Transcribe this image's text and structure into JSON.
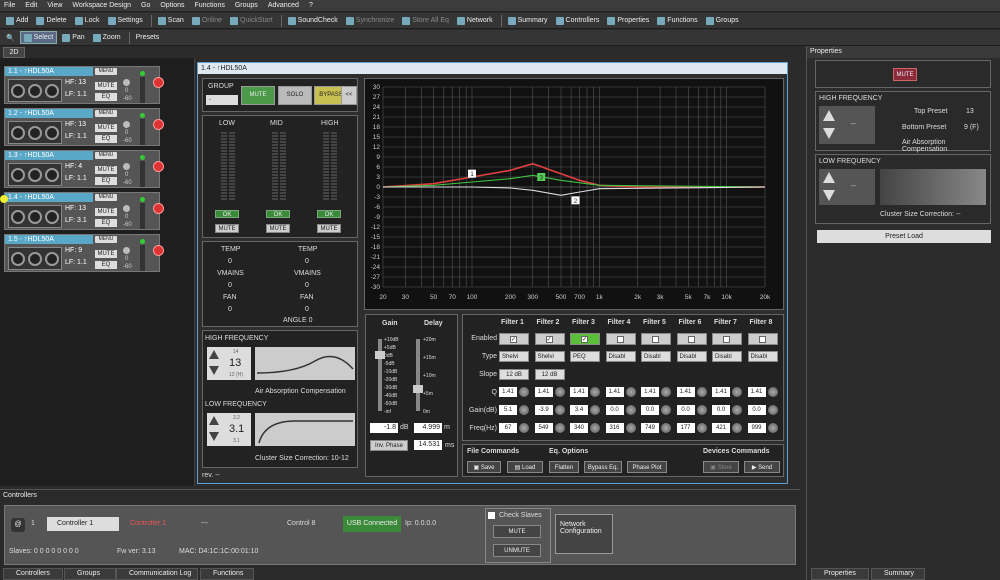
{
  "menubar": [
    "File",
    "Edit",
    "View",
    "Workspace Design",
    "Go",
    "Options",
    "Functions",
    "Groups",
    "Advanced",
    "?"
  ],
  "toolbar1": [
    {
      "label": "Add"
    },
    {
      "label": "Delete"
    },
    {
      "label": "Lock"
    },
    {
      "label": "Settings"
    },
    {
      "label": "Scan"
    },
    {
      "label": "Online",
      "disabled": true
    },
    {
      "label": "QuickStart",
      "disabled": true
    },
    {
      "label": "SoundCheck"
    },
    {
      "label": "Synchronize",
      "disabled": true
    },
    {
      "label": "Store All Eq",
      "disabled": true
    },
    {
      "label": "Network"
    },
    {
      "label": "Summary"
    },
    {
      "label": "Controllers"
    },
    {
      "label": "Properties"
    },
    {
      "label": "Functions"
    },
    {
      "label": "Groups"
    }
  ],
  "toolbar2": {
    "select": "Select",
    "pan": "Pan",
    "zoom": "Zoom",
    "presets": "Presets"
  },
  "tab2d": "2D",
  "devices": [
    {
      "name": "1.1 - ↑HDL50A",
      "hf": "HF: 13",
      "lf": "LF: 1.1",
      "menu": "MENU",
      "mute": "MUTE",
      "eq": "EQ",
      "top": "0",
      "bot": "-60",
      "alert": false
    },
    {
      "name": "1.2 - ↑HDL50A",
      "hf": "HF: 13",
      "lf": "LF: 1.1",
      "menu": "MENU",
      "mute": "MUTE",
      "eq": "EQ",
      "top": "0",
      "bot": "-60",
      "alert": false
    },
    {
      "name": "1.3 - ↑HDL50A",
      "hf": "HF: 4",
      "lf": "LF: 1.1",
      "menu": "MENU",
      "mute": "MUTE",
      "eq": "EQ",
      "top": "0",
      "bot": "-60",
      "alert": false
    },
    {
      "name": "1.4 - ↑HDL50A",
      "hf": "HF: 13",
      "lf": "LF: 3.1",
      "menu": "MENU",
      "mute": "MUTE",
      "eq": "EQ",
      "top": "0",
      "bot": "-60",
      "alert": true
    },
    {
      "name": "1.5 - ↑HDL50A",
      "hf": "HF: 9",
      "lf": "LF: 1.1",
      "menu": "MENU",
      "mute": "MUTE",
      "eq": "EQ",
      "top": "0",
      "bot": "-60",
      "alert": false
    }
  ],
  "window": {
    "title": "1.4 - ↑HDL50A",
    "group_label": "GROUP",
    "group_value": "-",
    "mute": "MUTE",
    "solo": "SOLO",
    "bypass": "BYPASS",
    "collapse": "<<",
    "bands": [
      {
        "label": "LOW",
        "ok": "OK",
        "mute": "MUTE"
      },
      {
        "label": "MID",
        "ok": "OK",
        "mute": "MUTE"
      },
      {
        "label": "HIGH",
        "ok": "OK",
        "mute": "MUTE"
      }
    ],
    "status": {
      "temp": "TEMP",
      "vmains": "VMAINS",
      "fan": "FAN",
      "angle": "ANGLE 0",
      "v": "0"
    },
    "hf": {
      "title": "HIGH FREQUENCY",
      "value": "13",
      "top": "14",
      "bot": "12 (H)",
      "caption": "Air Absorption Compensation"
    },
    "lf": {
      "title": "LOW FREQUENCY",
      "value": "3.1",
      "top": "3.2",
      "bot": "3.1",
      "caption": "Cluster Size Correction: 10-12"
    },
    "rev": "rev. --",
    "gain_label": "Gain",
    "delay_label": "Delay",
    "gain_scale": [
      "+10dB",
      "+5dB",
      "0dB",
      "-5dB",
      "-10dB",
      "-20dB",
      "-30dB",
      "-40dB",
      "-50dB",
      "-inf"
    ],
    "delay_scale": [
      "+20m",
      "+15m",
      "+10m",
      "+5m",
      "0m"
    ],
    "gain_value": "-1.8",
    "gain_unit": "dB",
    "delay_value": "4.999",
    "delay_unit": "m",
    "inv_phase": "Inv. Phase",
    "delay_ms": "14.531",
    "ms_unit": "ms"
  },
  "chart_data": {
    "type": "line",
    "y_ticks": [
      "30",
      "27",
      "24",
      "21",
      "18",
      "15",
      "12",
      "9",
      "6",
      "3",
      "0",
      "-3",
      "-6",
      "-9",
      "-12",
      "-15",
      "-18",
      "-21",
      "-24",
      "-27",
      "-30"
    ],
    "x_ticks": [
      "20",
      "30",
      "50",
      "70",
      "100",
      "200",
      "300",
      "500",
      "700",
      "1k",
      "2k",
      "3k",
      "5k",
      "7k",
      "10k",
      "20k"
    ],
    "ylim": [
      -30,
      30
    ],
    "x_scale": "log",
    "xlim": [
      20,
      20000
    ],
    "series": [
      {
        "color": "#e04040",
        "x": [
          20,
          50,
          100,
          200,
          300,
          500,
          700,
          1000,
          2000,
          20000
        ],
        "y": [
          0,
          1,
          3,
          5,
          7,
          4,
          2,
          0.5,
          0,
          0
        ]
      },
      {
        "color": "#40c040",
        "x": [
          20,
          50,
          100,
          200,
          300,
          500,
          1000,
          20000
        ],
        "y": [
          0,
          0.5,
          1.5,
          2.5,
          3.5,
          2,
          0.5,
          0
        ]
      },
      {
        "color": "#dddddd",
        "x": [
          20,
          100,
          200,
          300,
          500,
          700,
          1000,
          20000
        ],
        "y": [
          0,
          0,
          -0.3,
          -1,
          -2.5,
          -1.5,
          -0.5,
          0
        ]
      }
    ],
    "markers": [
      {
        "label": "1",
        "x": 100,
        "y": 4
      },
      {
        "label": "3",
        "x": 350,
        "y": 3
      },
      {
        "label": "2",
        "x": 650,
        "y": -4
      }
    ]
  },
  "filters": {
    "headers": [
      "Filter 1",
      "Filter 2",
      "Filter 3",
      "Filter 4",
      "Filter 5",
      "Filter 6",
      "Filter 7",
      "Filter 8"
    ],
    "rows": {
      "enabled": "Enabled",
      "type": "Type",
      "slope": "Slope",
      "q": "Q",
      "gain": "Gain(dB)",
      "freq": "Freq(Hz)"
    },
    "types": [
      "Shelvi",
      "Shelvi",
      "PEQ",
      "Disabl",
      "Disabl",
      "Disabl",
      "Disabl",
      "Disabl"
    ],
    "slopes": [
      "12 dB",
      "12 dB"
    ],
    "q": [
      "1.41",
      "1.41",
      "1.41",
      "1.41",
      "1.41",
      "1.41",
      "1.41",
      "1.41"
    ],
    "gain": [
      "5.1",
      "-3.9",
      "3.4",
      "0.0",
      "0.0",
      "0.0",
      "0.0",
      "0.0"
    ],
    "freq": [
      "67",
      "549",
      "340",
      "316",
      "749",
      "177",
      "421",
      "999"
    ]
  },
  "commands": {
    "file": "File Commands",
    "save": "Save",
    "load": "Load",
    "eq": "Eq. Options",
    "flatten": "Flatten",
    "bypass": "Bypass Eq.",
    "phase": "Phase Plot",
    "devices": "Devices Commands",
    "store": "Store",
    "send": "Send"
  },
  "props": {
    "title": "Properties",
    "mute": "MUTE",
    "hf_title": "HIGH FREQUENCY",
    "top_preset": "Top Preset",
    "top_val": "13",
    "bottom_preset": "Bottom Preset",
    "bottom_val": "9 (F)",
    "hf_caption": "Air Absorption Compensation",
    "lf_title": "LOW FREQUENCY",
    "lf_caption": "Cluster Size Correction: --",
    "dash": "--",
    "preset_load": "Preset Load",
    "tab_props": "Properties",
    "tab_summary": "Summary"
  },
  "controllers": {
    "title": "Controllers",
    "num": "1",
    "ctrl": "Controller 1",
    "ctrl_red": "Controller 1",
    "dash": "---",
    "ctrl8": "Control 8",
    "usb": "USB Connected",
    "ip": "Ip: 0.0.0.0",
    "slaves": "Slaves: 0  0  0  0  0  0  0  0",
    "fw": "Fw ver:  3.13",
    "mac": "MAC: D4:1C:1C:00:01:10",
    "check": "Check Slaves",
    "mute": "MUTE",
    "unmute": "UNMUTE",
    "net": "Network Configuration"
  },
  "bottom_tabs": [
    "Controllers",
    "Groups",
    "Communication Log",
    "Functions"
  ]
}
